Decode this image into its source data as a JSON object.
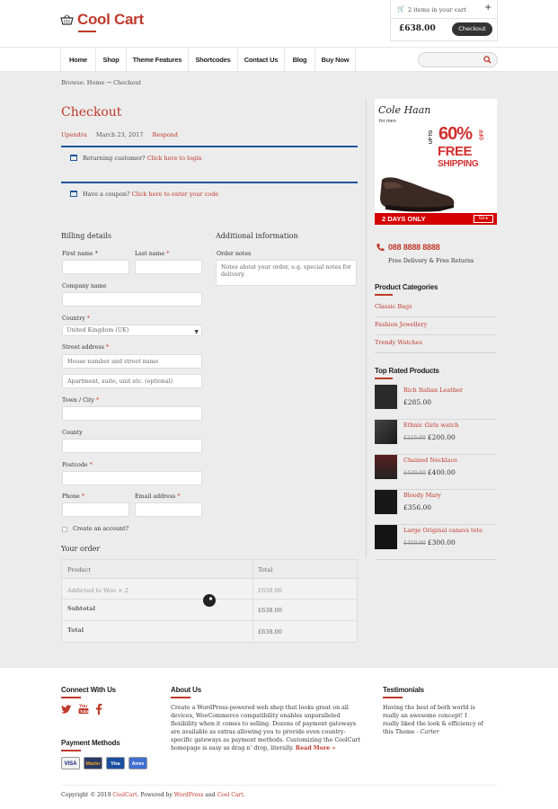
{
  "header": {
    "logo_text": "Cool Cart",
    "cart_items": "2 items in your cart",
    "cart_plus": "+",
    "cart_total": "£638.00",
    "checkout_label": "Checkout"
  },
  "nav": {
    "items": [
      "Home",
      "Shop",
      "Theme Features",
      "Shortcodes",
      "Contact Us",
      "Blog",
      "Buy Now"
    ],
    "search_placeholder": ""
  },
  "breadcrumb": "Browse: Home → Checkout",
  "page": {
    "title": "Checkout",
    "author": "Upendra",
    "date": "March 23, 2017",
    "respond": "Respond"
  },
  "notices": {
    "returning_prefix": "Returning customer?",
    "returning_link": "Click here to login",
    "coupon_prefix": "Have a coupon?",
    "coupon_link": "Click here to enter your code"
  },
  "billing": {
    "title": "Billing details",
    "first_name": "First name",
    "last_name": "Last name",
    "company": "Company name",
    "country": "Country",
    "country_value": "United Kingdom (UK)",
    "street": "Street address",
    "street_placeholder1": "House number and street name",
    "street_placeholder2": "Apartment, suite, unit etc. (optional)",
    "city": "Town / City",
    "county": "County",
    "postcode": "Postcode",
    "phone": "Phone",
    "email": "Email address",
    "create_account": "Create an account?",
    "required_mark": "*"
  },
  "additional": {
    "title": "Additional information",
    "order_notes": "Order notes",
    "order_notes_placeholder": "Notes about your order, e.g. special notes for delivery."
  },
  "order": {
    "title": "Your order",
    "col_product": "Product",
    "col_total": "Total",
    "rows": [
      {
        "label": "Addicted to Woo  × 2",
        "value": "£658.00"
      },
      {
        "label": "Subtotal",
        "value": "£638.00"
      },
      {
        "label": "Total",
        "value": "£638.00"
      }
    ]
  },
  "sidebar": {
    "ad": {
      "brand": "Cole Haan",
      "for_men": "for men",
      "upto": "UP TO",
      "percent": "60%",
      "off": "OFF",
      "free": "FREE",
      "shipping": "SHIPPING",
      "days": "2 DAYS ONLY",
      "go": "Go ▸"
    },
    "phone": "088 8888 8888",
    "phone_sub": "Free Delivery & Free Returns",
    "categories_title": "Product Categories",
    "categories": [
      "Classic Bags",
      "Fashion Jewellery",
      "Trendy Watches"
    ],
    "top_rated_title": "Top Rated Products",
    "products": [
      {
        "name": "Rich Italian Leather",
        "old": "",
        "price": "£285.00"
      },
      {
        "name": "Ethnic Girls watch",
        "old": "£225.00",
        "price": "£200.00"
      },
      {
        "name": "Chained Necklace",
        "old": "£430.00",
        "price": "£400.00"
      },
      {
        "name": "Bloody Mary",
        "old": "",
        "price": "£356.00"
      },
      {
        "name": "Large Original canavs tote",
        "old": "£450.00",
        "price": "£300.00"
      }
    ]
  },
  "footer": {
    "connect_title": "Connect With Us",
    "payment_title": "Payment Methods",
    "payment_labels": [
      "VISA",
      "Master",
      "Visa",
      "Amex"
    ],
    "about_title": "About Us",
    "about_text": "Create a WordPress-powered web shop that looks great on all devices, WooCommerce compatibility enables unparalleled flexibility when it comes to selling. Dozens of payment gateways are available as extras allowing you to provide even country-specific gateways as payment methods. Customizing the CoolCart homepage is easy as drag n' drop, literally.",
    "read_more": "Read More »",
    "testimonials_title": "Testimonials",
    "testimonial_text": "Having the best of both world is really an awesome concept! I really liked the look & efficiency of this Theme -",
    "testimonial_author": "Carter",
    "copyright_prefix": "Copyright © 2019",
    "copyright_site": "CoolCart",
    "copyright_mid": ". Powered by",
    "copyright_wp": "WordPress",
    "copyright_and": "and",
    "copyright_theme": "Cool Cart",
    "copyright_end": "."
  },
  "colors": {
    "accent": "#c0392b",
    "notice": "#1e5799",
    "bg": "#ececec"
  }
}
